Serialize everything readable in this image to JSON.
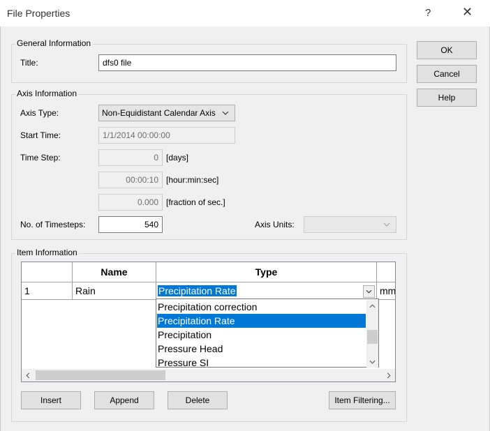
{
  "window": {
    "title": "File Properties",
    "help_glyph": "?",
    "close_glyph": "✕"
  },
  "buttons": {
    "ok": "OK",
    "cancel": "Cancel",
    "help": "Help"
  },
  "general": {
    "label": "General Information",
    "title_label": "Title:",
    "title_value": "dfs0 file"
  },
  "axis": {
    "label": "Axis Information",
    "type_label": "Axis Type:",
    "type_value": "Non-Equidistant Calendar Axis",
    "start_label": "Start Time:",
    "start_value": "1/1/2014 00:00:00",
    "step_label": "Time Step:",
    "step_days": "0",
    "step_days_unit": "[days]",
    "step_hms": "00:00:10",
    "step_hms_unit": "[hour:min:sec]",
    "step_frac": "0.000",
    "step_frac_unit": "[fraction of sec.]",
    "count_label": "No. of Timesteps:",
    "count_value": "540",
    "units_label": "Axis Units:",
    "units_value": ""
  },
  "items": {
    "label": "Item Information",
    "columns": [
      "",
      "Name",
      "Type",
      ""
    ],
    "rows": [
      {
        "index": "1",
        "name": "Rain",
        "type": "Precipitation Rate",
        "unit": "mm"
      }
    ],
    "type_options": [
      "Precipitation correction",
      "Precipitation Rate",
      "Precipitation",
      "Pressure Head",
      "Pressure SI"
    ],
    "selected_option": "Precipitation Rate",
    "buttons": {
      "insert": "Insert",
      "append": "Append",
      "delete": "Delete",
      "filter": "Item Filtering..."
    }
  }
}
